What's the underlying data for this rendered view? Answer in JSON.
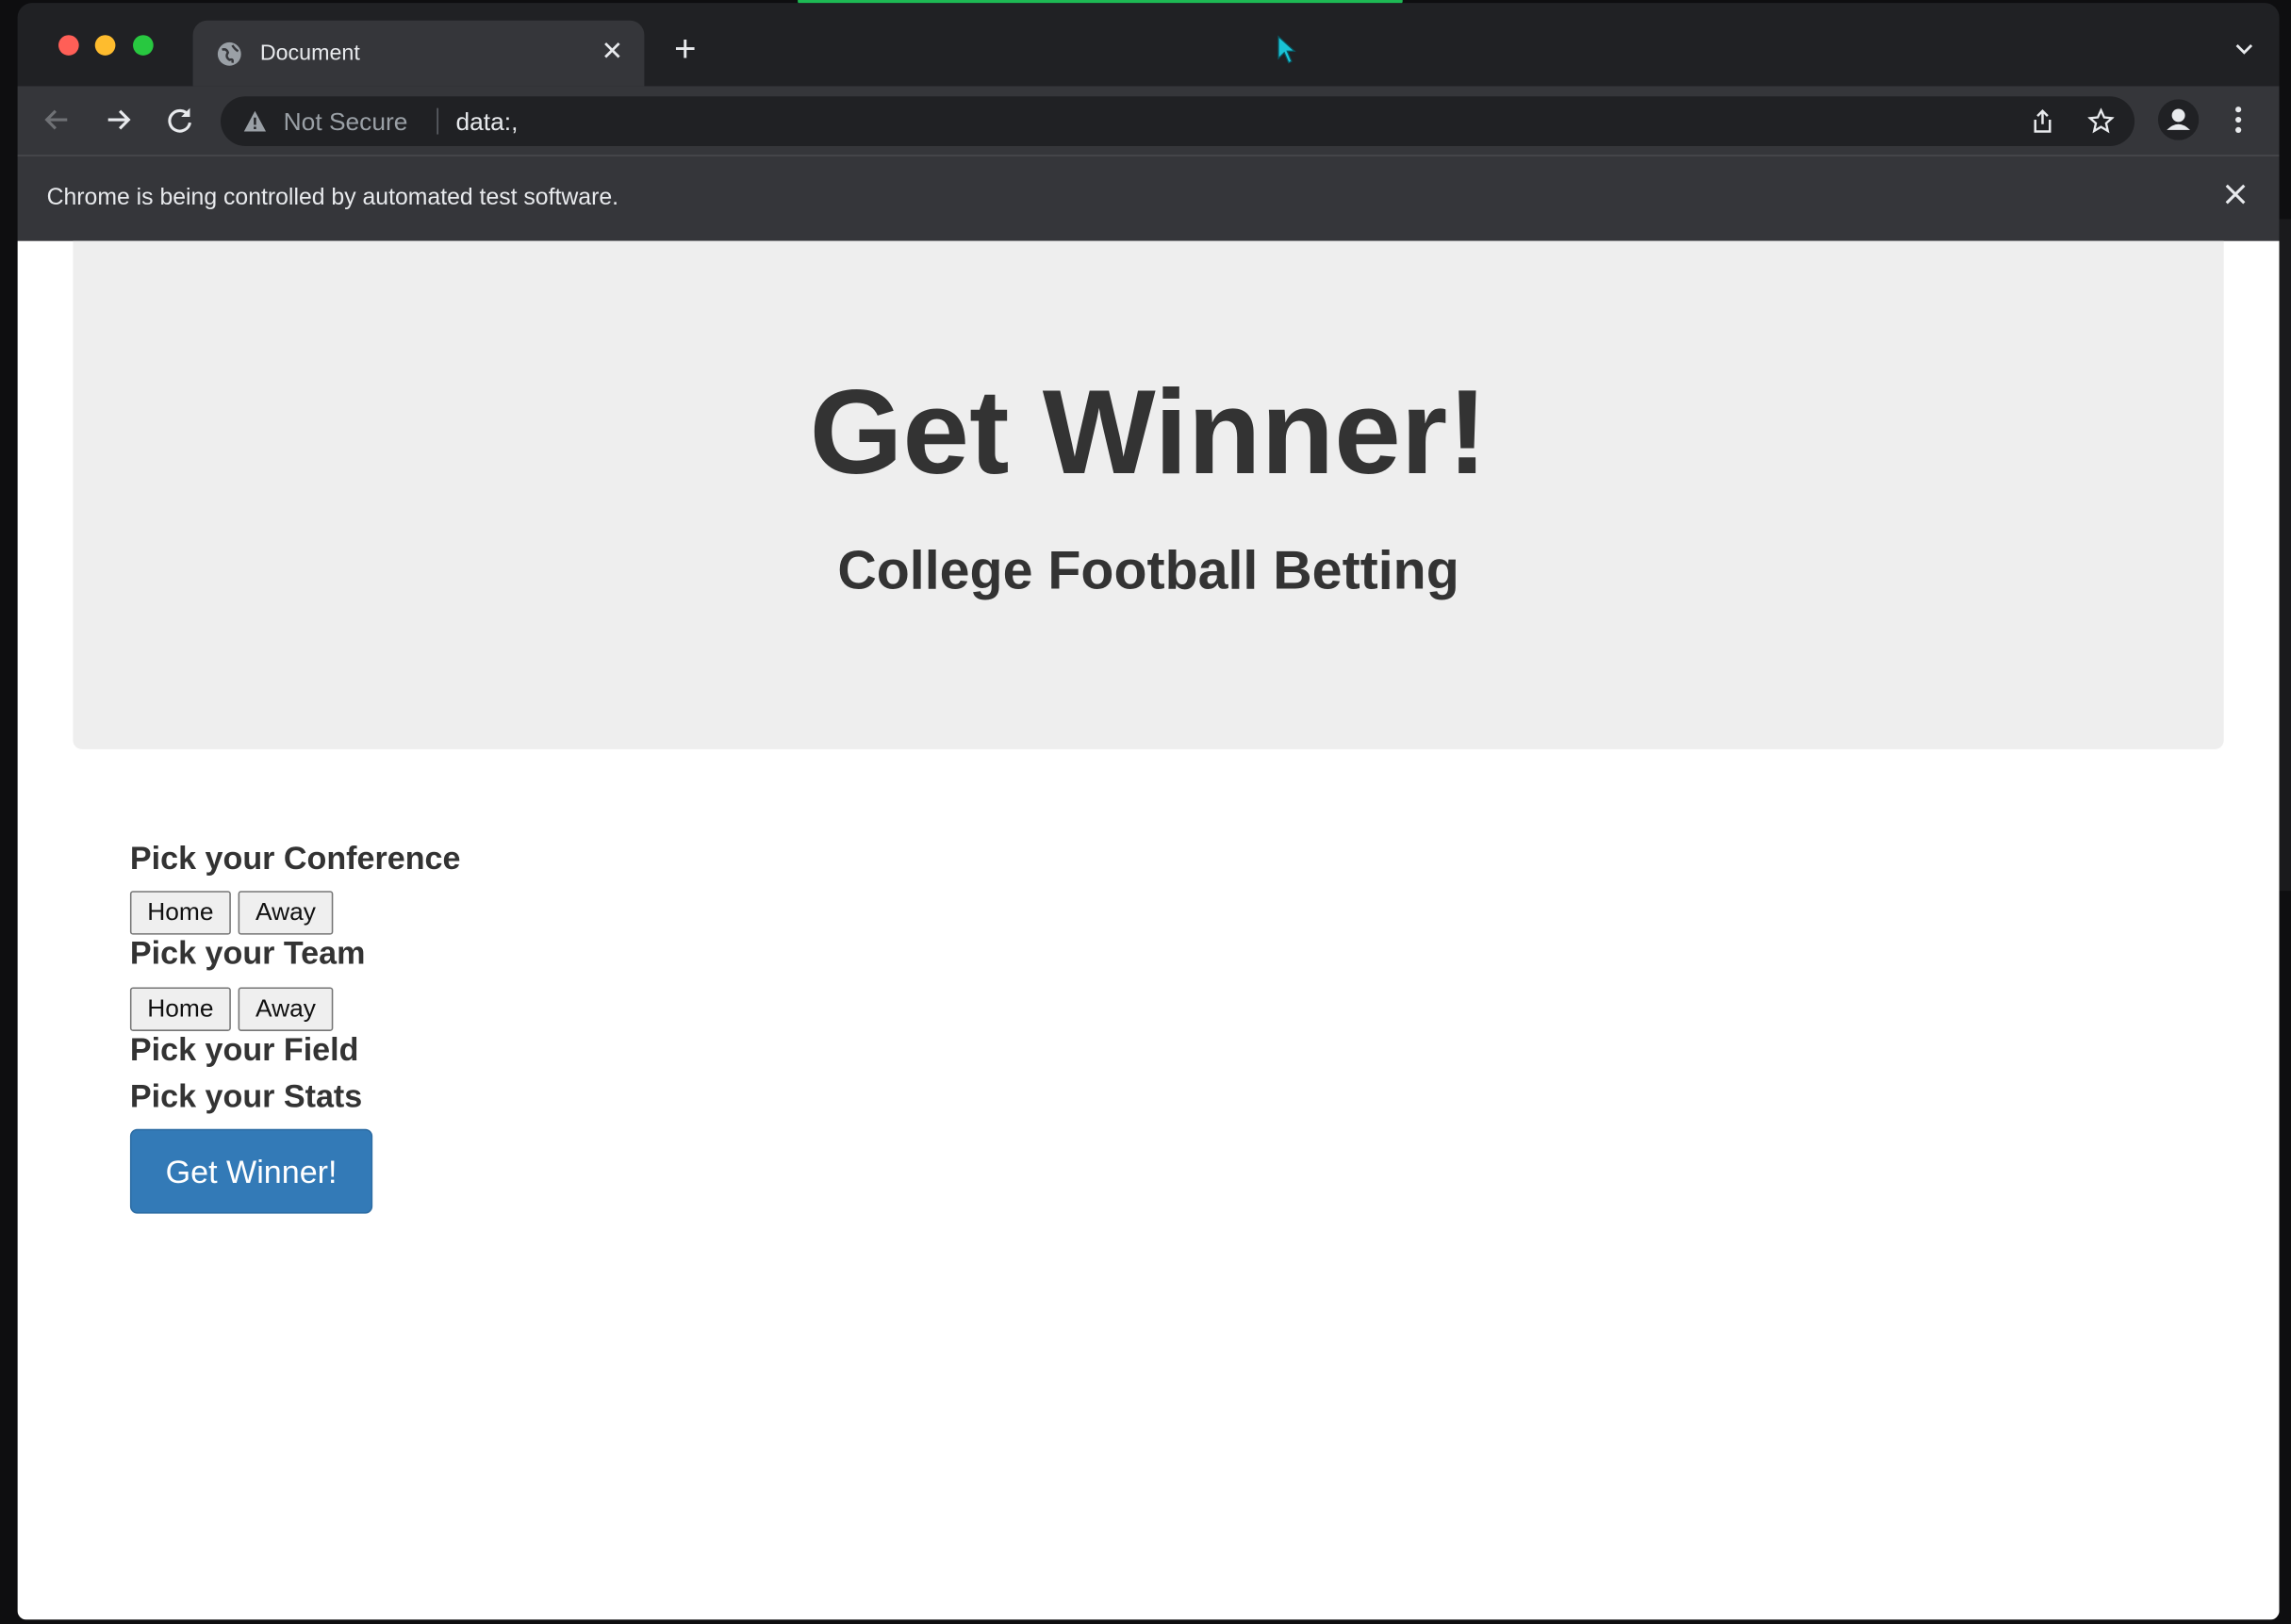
{
  "browser": {
    "tab_title": "Document",
    "tab_close": "✕",
    "new_tab": "+",
    "security_label": "Not Secure",
    "url": "data:,",
    "infobar_text": "Chrome is being controlled by automated test software."
  },
  "page": {
    "title": "Get Winner!",
    "subtitle": "College Football Betting",
    "sections": {
      "conference": {
        "label": "Pick your Conference",
        "home": "Home",
        "away": "Away"
      },
      "team": {
        "label": "Pick your Team",
        "home": "Home",
        "away": "Away"
      },
      "field": {
        "label": "Pick your Field"
      },
      "stats": {
        "label": "Pick your Stats"
      }
    },
    "submit_label": "Get Winner!"
  },
  "colors": {
    "primary_button": "#337ab7",
    "jumbotron_bg": "#eeeeee",
    "load_bar": "#1db954"
  }
}
